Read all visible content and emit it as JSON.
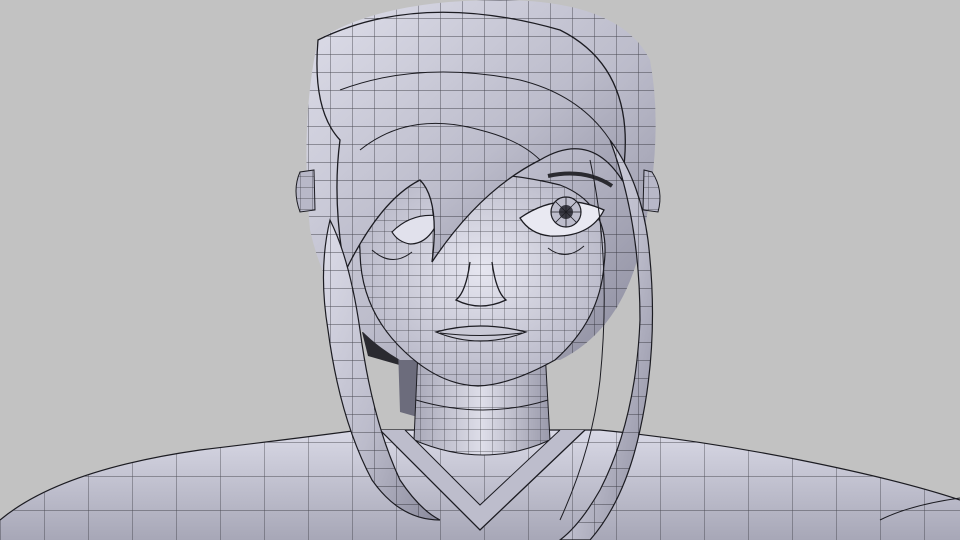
{
  "viewport": {
    "background_color": "#c2c2c2",
    "mesh_base_color": "#cfcfdc",
    "mesh_shadow_color": "#7f7f8f",
    "wire_color": "#1c1c22"
  },
  "subject": {
    "icon": "wireframe-character-head-icon",
    "regions": [
      "hair",
      "face",
      "left-eye",
      "right-eye",
      "neck",
      "shoulders",
      "collar",
      "ribbon"
    ]
  }
}
